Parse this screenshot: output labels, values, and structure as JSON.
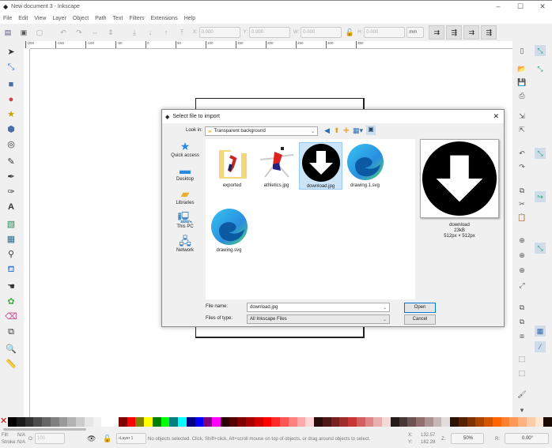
{
  "window": {
    "title": "New document 3 - Inkscape",
    "minimize": "–",
    "maximize": "☐",
    "close": "✕"
  },
  "menu": [
    "File",
    "Edit",
    "View",
    "Layer",
    "Object",
    "Path",
    "Text",
    "Filters",
    "Extensions",
    "Help"
  ],
  "toolbar": {
    "x_label": "X:",
    "x_value": "0.000",
    "y_label": "Y:",
    "y_value": "0.000",
    "w_label": "W:",
    "w_value": "0.000",
    "h_label": "H:",
    "h_value": "0.000",
    "unit": "mm"
  },
  "ruler_labels": [
    "-200",
    "-150",
    "-100",
    "-50",
    "0",
    "50",
    "100",
    "150",
    "200",
    "250",
    "300",
    "350"
  ],
  "dialog": {
    "title": "Select file to import",
    "close": "✕",
    "look_in_label": "Look in:",
    "look_in_value": "Transparent background",
    "places": [
      {
        "label": "Quick access",
        "icon": "star-icon"
      },
      {
        "label": "Desktop",
        "icon": "desktop-icon"
      },
      {
        "label": "Libraries",
        "icon": "libraries-icon"
      },
      {
        "label": "This PC",
        "icon": "computer-icon"
      },
      {
        "label": "Network",
        "icon": "network-icon"
      }
    ],
    "files": [
      {
        "name": "exported",
        "type": "folder"
      },
      {
        "name": "athletics.jpg",
        "type": "image"
      },
      {
        "name": "download.jpg",
        "type": "image",
        "selected": true
      },
      {
        "name": "drawing 1.svg",
        "type": "svg"
      },
      {
        "name": "drawing.svg",
        "type": "svg"
      }
    ],
    "preview": {
      "name": "download",
      "size": "23kB",
      "dims": "512px × 512px"
    },
    "file_name_label": "File name:",
    "file_name_value": "download.jpg",
    "file_type_label": "Files of type:",
    "file_type_value": "All Inkscape Files",
    "open": "Open",
    "cancel": "Cancel"
  },
  "status": {
    "fill_label": "Fill:",
    "fill_value": "N/A",
    "stroke_label": "Stroke:",
    "stroke_value": "N/A",
    "opacity_label": "O:",
    "opacity_value": "100",
    "layer": "•Layer 1",
    "message": "No objects selected. Click, Shift+click, Alt+scroll mouse on top of objects, or drag around objects to select.",
    "x_label": "X:",
    "x_value": "132.57",
    "y_label": "Y:",
    "y_value": "182.28",
    "zoom_label": "Z:",
    "zoom_value": "50%",
    "rotate_label": "R:",
    "rotate_value": "0.00°"
  },
  "palette": [
    "#000000",
    "#1a1a1a",
    "#333333",
    "#4d4d4d",
    "#666666",
    "#808080",
    "#999999",
    "#b3b3b3",
    "#cccccc",
    "#e6e6e6",
    "#f2f2f2",
    "#ffffff",
    "#ffffff",
    "#800000",
    "#ff0000",
    "#808000",
    "#ffff00",
    "#008000",
    "#00ff00",
    "#008080",
    "#00ffff",
    "#000080",
    "#0000ff",
    "#800080",
    "#ff00ff",
    "#2b0000",
    "#550000",
    "#800000",
    "#aa0000",
    "#d40000",
    "#ff0000",
    "#ff2a2a",
    "#ff5555",
    "#ff8080",
    "#ffaaaa",
    "#ffd5d5",
    "#280b0b",
    "#501616",
    "#782121",
    "#a02c2c",
    "#c83737",
    "#d35f5f",
    "#de8787",
    "#e9afaf",
    "#f4d7d7",
    "#241c1c",
    "#483737",
    "#6c5353",
    "#916f6f",
    "#ac9393",
    "#c8b7b7",
    "#e3dbdb",
    "#2b1100",
    "#552200",
    "#803300",
    "#aa4400",
    "#d45500",
    "#ff6600",
    "#ff7f2a",
    "#ff9955",
    "#ffb380",
    "#ffccaa",
    "#ffe6d5",
    "#1a0a00"
  ]
}
